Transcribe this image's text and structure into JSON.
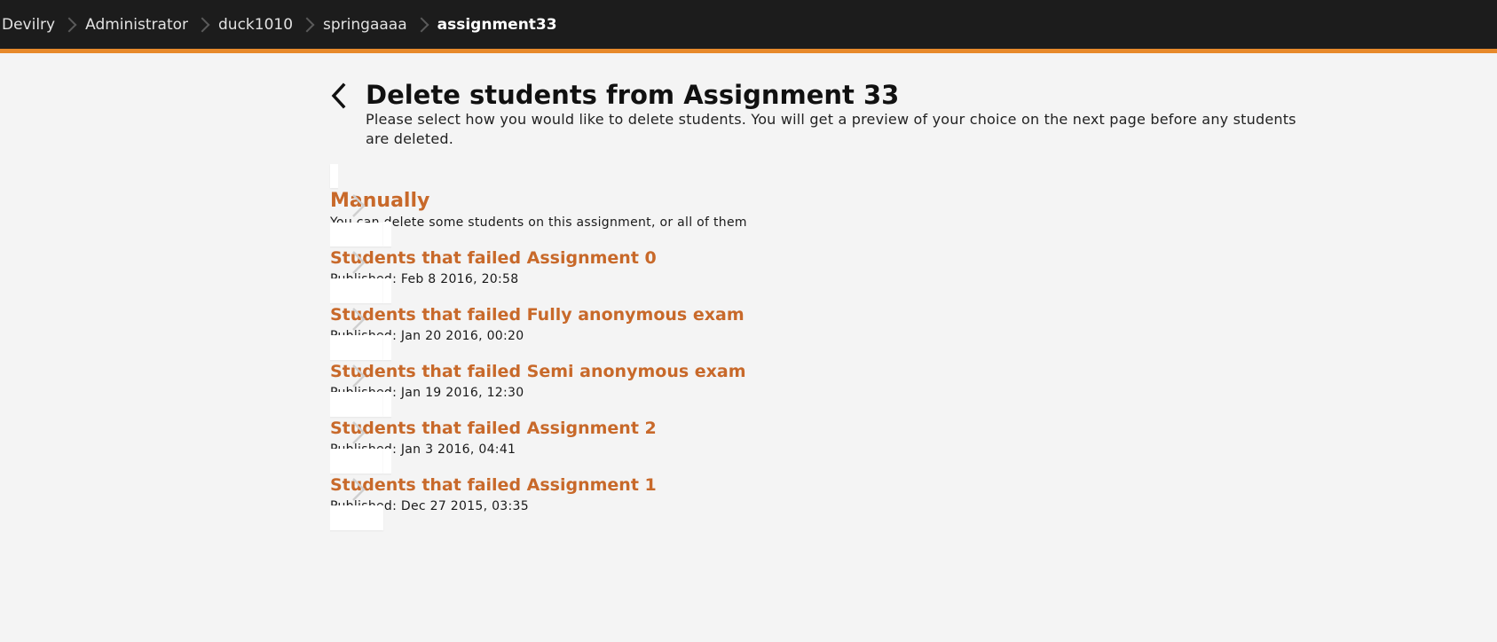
{
  "breadcrumb": {
    "items": [
      "Devilry",
      "Administrator",
      "duck1010",
      "springaaaa"
    ],
    "current": "assignment33"
  },
  "icons": {
    "back": "chevron-left-icon",
    "separator": "chevron-right-icon",
    "option_arrow": "chevron-right-icon"
  },
  "colors": {
    "accent": "#e7892b",
    "title_orange": "#c8692a",
    "topbar": "#1c1c1c",
    "background": "#f4f4f4"
  },
  "header": {
    "title": "Delete students from Assignment 33",
    "description": "Please select how you would like to delete students. You will get a preview of your choice on the next page before any students are deleted."
  },
  "options": [
    {
      "title": "Manually",
      "subtitle": "You can delete some students on this assignment, or all of them"
    },
    {
      "title": "Students that failed Assignment 0",
      "subtitle": "Published: Feb 8 2016, 20:58"
    },
    {
      "title": "Students that failed Fully anonymous exam",
      "subtitle": "Published: Jan 20 2016, 00:20"
    },
    {
      "title": "Students that failed Semi anonymous exam",
      "subtitle": "Published: Jan 19 2016, 12:30"
    },
    {
      "title": "Students that failed Assignment 2",
      "subtitle": "Published: Jan 3 2016, 04:41"
    },
    {
      "title": "Students that failed Assignment 1",
      "subtitle": "Published: Dec 27 2015, 03:35"
    }
  ]
}
